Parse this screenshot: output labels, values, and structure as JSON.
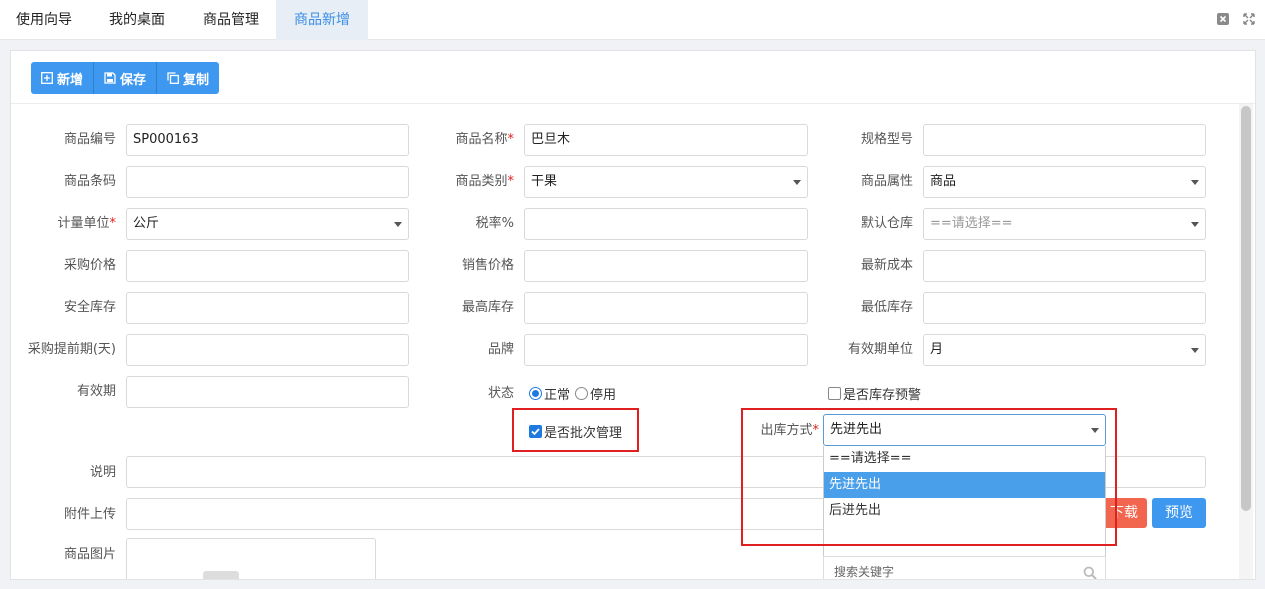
{
  "tabs": [
    {
      "label": "使用向导",
      "active": false
    },
    {
      "label": "我的桌面",
      "active": false
    },
    {
      "label": "商品管理",
      "active": false
    },
    {
      "label": "商品新增",
      "active": true
    }
  ],
  "toolbar": {
    "add_label": "新增",
    "save_label": "保存",
    "copy_label": "复制"
  },
  "form": {
    "code_label": "商品编号",
    "code_value": "SP000163",
    "name_label": "商品名称",
    "name_value": "巴旦木",
    "spec_label": "规格型号",
    "spec_value": "",
    "barcode_label": "商品条码",
    "barcode_value": "",
    "category_label": "商品类别",
    "category_value": "干果",
    "attr_label": "商品属性",
    "attr_value": "商品",
    "unit_label": "计量单位",
    "unit_value": "公斤",
    "tax_label": "税率%",
    "tax_value": "",
    "warehouse_label": "默认仓库",
    "warehouse_value": "==请选择==",
    "purchase_price_label": "采购价格",
    "purchase_price_value": "",
    "sale_price_label": "销售价格",
    "sale_price_value": "",
    "latest_cost_label": "最新成本",
    "latest_cost_value": "",
    "safety_stock_label": "安全库存",
    "safety_stock_value": "",
    "max_stock_label": "最高库存",
    "max_stock_value": "",
    "min_stock_label": "最低库存",
    "min_stock_value": "",
    "lead_time_label": "采购提前期(天)",
    "lead_time_value": "",
    "brand_label": "品牌",
    "brand_value": "",
    "expiry_unit_label": "有效期单位",
    "expiry_unit_value": "月",
    "expiry_label": "有效期",
    "expiry_value": "",
    "status_label": "状态",
    "status_normal": "正常",
    "status_disabled": "停用",
    "stock_warning_label": "是否库存预警",
    "batch_label": "是否批次管理",
    "outbound_label": "出库方式",
    "outbound_value": "先进先出",
    "desc_label": "说明",
    "desc_value": "",
    "attachment_label": "附件上传",
    "download_label": "下载",
    "preview_label": "预览",
    "image_label": "商品图片"
  },
  "dropdown": {
    "options": [
      "==请选择==",
      "先进先出",
      "后进先出"
    ],
    "selected_index": 1,
    "search_placeholder": "搜索关键字"
  },
  "colors": {
    "accent": "#3e98f0",
    "danger": "#f2664f",
    "highlight": "#e02020",
    "active_tab": "#3a8ee6"
  }
}
